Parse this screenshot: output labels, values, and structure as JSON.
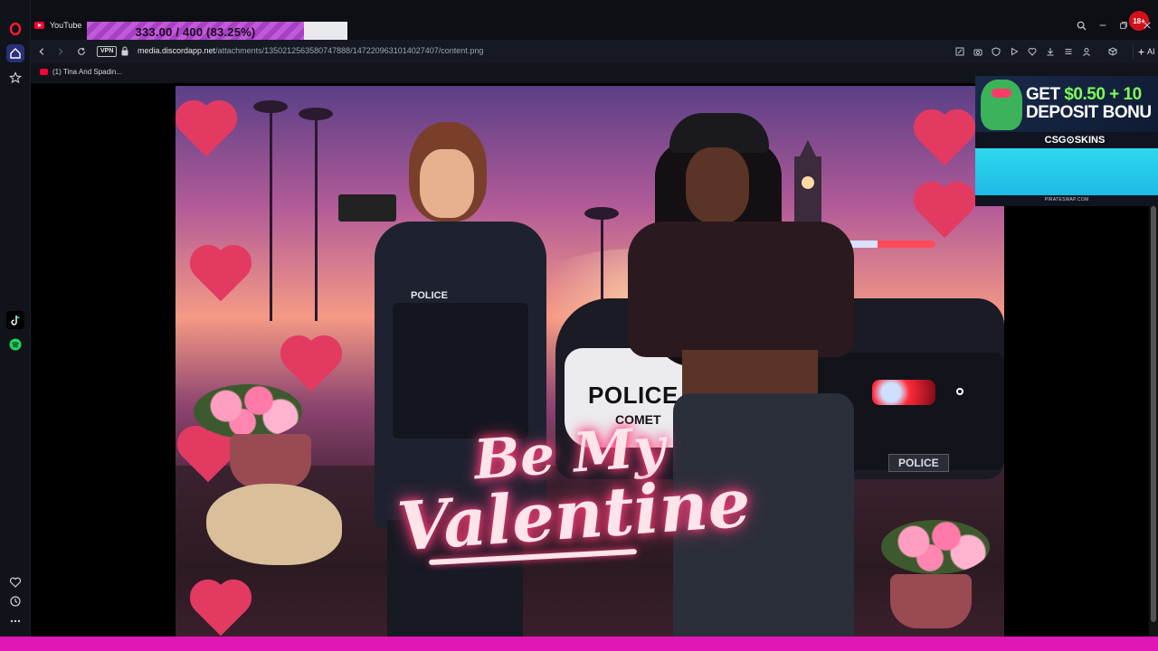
{
  "tab": {
    "title": "YouTube"
  },
  "overlay": {
    "counter_text": "333.00 / 400 (83.25%)"
  },
  "badge": {
    "text": "18+"
  },
  "addressbar": {
    "vpn_label": "VPN",
    "url_host": "media.discordapp.net",
    "url_path": "/attachments/1350212563580747888/1472209631014027407/content.png",
    "ai_label": "AI"
  },
  "bookmarks": [
    {
      "label": "(1) Tina And Spadin..."
    }
  ],
  "image": {
    "title_line1": "Be My",
    "title_line2": "Valentine",
    "car_door_text": "POLICE",
    "car_door_subtext": "COMET",
    "car_rear_text": "POLICE",
    "officer_badge_text": "POLICE"
  },
  "ad": {
    "line1_white": "GET ",
    "line1_green": "$0.50 + 10",
    "line2": "DEPOSIT BONU",
    "brand": "CSG⊙SKINS",
    "footer": "PIRATESWAP.COM"
  },
  "colors": {
    "accent_bottom": "#e016b6",
    "counter_fill": "#c05ad8",
    "badge": "#d3101c"
  },
  "icons": {
    "sidebar": [
      "opera-logo-icon",
      "home-icon",
      "star-icon",
      "tiktok-icon",
      "spotify-icon",
      "heart-icon",
      "history-icon",
      "more-icon"
    ],
    "toolbar": [
      "edit-icon",
      "camera-icon",
      "shield-icon",
      "play-icon",
      "heart-icon",
      "download-icon",
      "menu-icon",
      "profile-icon",
      "cube-icon"
    ]
  }
}
